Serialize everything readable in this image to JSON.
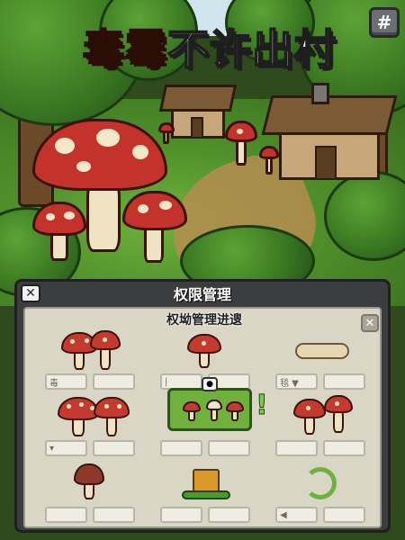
{
  "title": {
    "part_red": "毒霉",
    "part_white": "不许出村"
  },
  "settings": {
    "icon": "#"
  },
  "dialog": {
    "title": "权限管理",
    "subtitle": "权坳管理进遚",
    "close_icon": "✕",
    "panel_close_icon": "✕",
    "selected_alert": "!",
    "cells": [
      {
        "slot_a": "毒",
        "slot_b": ""
      },
      {
        "slot_a": "|",
        "slot_b": ""
      },
      {
        "slot_a": "毯 ▼",
        "slot_b": ""
      },
      {
        "slot_a": "▾",
        "slot_b": ""
      },
      {
        "slot_a": "",
        "slot_b": ""
      },
      {
        "slot_a": "",
        "slot_b": ""
      },
      {
        "slot_a": "",
        "slot_b": ""
      },
      {
        "slot_a": "",
        "slot_b": ""
      },
      {
        "slot_a": "◀",
        "slot_b": ""
      }
    ]
  },
  "colors": {
    "title_red": "#d93a2a",
    "panel_bg": "#d9d6c6",
    "dialog_bg": "#3b3d3f",
    "grass": "#6fb13c"
  }
}
